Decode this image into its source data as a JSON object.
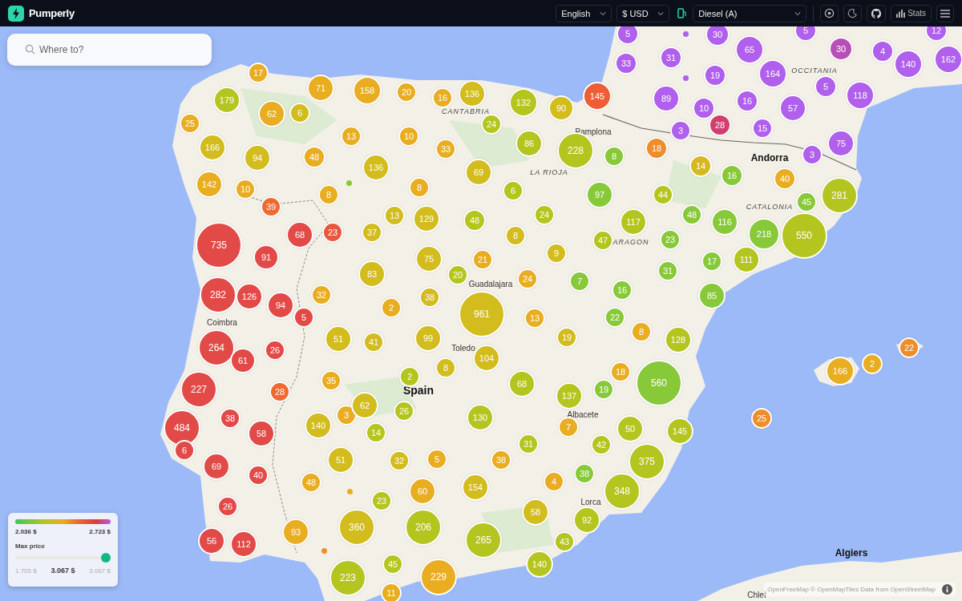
{
  "header": {
    "app_name": "Pumperly",
    "language": "English",
    "currency": "$ USD",
    "fuel": "Diesel (A)",
    "stats_label": "Stats"
  },
  "search": {
    "placeholder": "Where to?"
  },
  "map_labels": [
    {
      "text": "CANTABRIA",
      "kind": "region"
    },
    {
      "text": "Pamplona",
      "kind": "city"
    },
    {
      "text": "LA RIOJA",
      "kind": "region"
    },
    {
      "text": "OCCITANIA",
      "kind": "region"
    },
    {
      "text": "Andorra",
      "kind": "major"
    },
    {
      "text": "CATALONIA",
      "kind": "region"
    },
    {
      "text": "ARAGON",
      "kind": "region"
    },
    {
      "text": "Guadalajara",
      "kind": "city"
    },
    {
      "text": "Toledo",
      "kind": "city"
    },
    {
      "text": "Spain",
      "kind": "country"
    },
    {
      "text": "Coimbra",
      "kind": "city"
    },
    {
      "text": "Albacete",
      "kind": "city"
    },
    {
      "text": "Lorca",
      "kind": "city"
    },
    {
      "text": "Algiers",
      "kind": "major"
    },
    {
      "text": "Chlef",
      "kind": "city"
    }
  ],
  "clusters": [
    {
      "kind": "cluster",
      "count": "5",
      "color": "#b060ec"
    },
    {
      "kind": "dot",
      "color": "#b060ec"
    },
    {
      "kind": "cluster",
      "count": "30",
      "color": "#b060ec"
    },
    {
      "kind": "cluster",
      "count": "5",
      "color": "#b060ec"
    },
    {
      "kind": "cluster",
      "count": "12",
      "color": "#b060ec"
    },
    {
      "kind": "cluster",
      "count": "17",
      "color": "#e9ad22"
    },
    {
      "kind": "cluster",
      "count": "33",
      "color": "#b060ec"
    },
    {
      "kind": "cluster",
      "count": "31",
      "color": "#b060ec"
    },
    {
      "kind": "dot",
      "color": "#b060ec"
    },
    {
      "kind": "cluster",
      "count": "19",
      "color": "#b060ec"
    },
    {
      "kind": "cluster",
      "count": "65",
      "color": "#b060ec"
    },
    {
      "kind": "cluster",
      "count": "164",
      "color": "#b060ec"
    },
    {
      "kind": "cluster",
      "count": "30",
      "color": "#b84fb6"
    },
    {
      "kind": "cluster",
      "count": "4",
      "color": "#b060ec"
    },
    {
      "kind": "cluster",
      "count": "140",
      "color": "#b060ec"
    },
    {
      "kind": "cluster",
      "count": "162",
      "color": "#b060ec"
    },
    {
      "kind": "cluster",
      "count": "179",
      "color": "#b5c51f"
    },
    {
      "kind": "cluster",
      "count": "71",
      "color": "#e9ad22"
    },
    {
      "kind": "cluster",
      "count": "158",
      "color": "#e9ad22"
    },
    {
      "kind": "cluster",
      "count": "20",
      "color": "#e9ad22"
    },
    {
      "kind": "cluster",
      "count": "16",
      "color": "#e9ad22"
    },
    {
      "kind": "cluster",
      "count": "136",
      "color": "#d2bc1e"
    },
    {
      "kind": "cluster",
      "count": "132",
      "color": "#b5c51f"
    },
    {
      "kind": "cluster",
      "count": "90",
      "color": "#d2bc1e"
    },
    {
      "kind": "cluster",
      "count": "145",
      "color": "#ee5e36"
    },
    {
      "kind": "cluster",
      "count": "89",
      "color": "#b060ec"
    },
    {
      "kind": "cluster",
      "count": "10",
      "color": "#b060ec"
    },
    {
      "kind": "cluster",
      "count": "16",
      "color": "#b060ec"
    },
    {
      "kind": "cluster",
      "count": "57",
      "color": "#b060ec"
    },
    {
      "kind": "cluster",
      "count": "5",
      "color": "#b060ec"
    },
    {
      "kind": "cluster",
      "count": "118",
      "color": "#b060ec"
    },
    {
      "kind": "cluster",
      "count": "25",
      "color": "#e9ad22"
    },
    {
      "kind": "cluster",
      "count": "62",
      "color": "#e9ad22"
    },
    {
      "kind": "cluster",
      "count": "6",
      "color": "#d2bc1e"
    },
    {
      "kind": "cluster",
      "count": "13",
      "color": "#e9ad22"
    },
    {
      "kind": "cluster",
      "count": "10",
      "color": "#e9ad22"
    },
    {
      "kind": "cluster",
      "count": "24",
      "color": "#b5c51f"
    },
    {
      "kind": "cluster",
      "count": "3",
      "color": "#b060ec"
    },
    {
      "kind": "cluster",
      "count": "28",
      "color": "#d13f6f"
    },
    {
      "kind": "cluster",
      "count": "15",
      "color": "#b060ec"
    },
    {
      "kind": "cluster",
      "count": "166",
      "color": "#d2bc1e"
    },
    {
      "kind": "cluster",
      "count": "94",
      "color": "#d2bc1e"
    },
    {
      "kind": "cluster",
      "count": "48",
      "color": "#e9ad22"
    },
    {
      "kind": "cluster",
      "count": "136",
      "color": "#d2bc1e"
    },
    {
      "kind": "cluster",
      "count": "33",
      "color": "#e9ad22"
    },
    {
      "kind": "cluster",
      "count": "86",
      "color": "#b5c51f"
    },
    {
      "kind": "cluster",
      "count": "228",
      "color": "#b5c51f"
    },
    {
      "kind": "cluster",
      "count": "8",
      "color": "#88c93a"
    },
    {
      "kind": "cluster",
      "count": "18",
      "color": "#ef8c2b"
    },
    {
      "kind": "cluster",
      "count": "14",
      "color": "#d6b91e"
    },
    {
      "kind": "cluster",
      "count": "3",
      "color": "#b060ec"
    },
    {
      "kind": "cluster",
      "count": "75",
      "color": "#b060ec"
    },
    {
      "kind": "cluster",
      "count": "142",
      "color": "#e9ad22"
    },
    {
      "kind": "cluster",
      "count": "10",
      "color": "#e9ad22"
    },
    {
      "kind": "cluster",
      "count": "39",
      "color": "#ee6a30"
    },
    {
      "kind": "cluster",
      "count": "8",
      "color": "#e9ad22"
    },
    {
      "kind": "dot",
      "color": "#88c93a"
    },
    {
      "kind": "cluster",
      "count": "8",
      "color": "#e9ad22"
    },
    {
      "kind": "cluster",
      "count": "69",
      "color": "#d2bc1e"
    },
    {
      "kind": "cluster",
      "count": "6",
      "color": "#b5c51f"
    },
    {
      "kind": "cluster",
      "count": "97",
      "color": "#88c93a"
    },
    {
      "kind": "cluster",
      "count": "44",
      "color": "#b5c51f"
    },
    {
      "kind": "cluster",
      "count": "16",
      "color": "#88c93a"
    },
    {
      "kind": "cluster",
      "count": "40",
      "color": "#e9ad22"
    },
    {
      "kind": "cluster",
      "count": "45",
      "color": "#88c93a"
    },
    {
      "kind": "cluster",
      "count": "281",
      "color": "#b5c51f"
    },
    {
      "kind": "cluster",
      "count": "735",
      "color": "#e24a48"
    },
    {
      "kind": "cluster",
      "count": "91",
      "color": "#e24a48"
    },
    {
      "kind": "cluster",
      "count": "68",
      "color": "#e24a48"
    },
    {
      "kind": "cluster",
      "count": "23",
      "color": "#e8583e"
    },
    {
      "kind": "cluster",
      "count": "37",
      "color": "#d2bc1e"
    },
    {
      "kind": "cluster",
      "count": "13",
      "color": "#d2bc1e"
    },
    {
      "kind": "cluster",
      "count": "129",
      "color": "#d2bc1e"
    },
    {
      "kind": "cluster",
      "count": "48",
      "color": "#b5c51f"
    },
    {
      "kind": "cluster",
      "count": "8",
      "color": "#d2bc1e"
    },
    {
      "kind": "cluster",
      "count": "24",
      "color": "#b5c51f"
    },
    {
      "kind": "cluster",
      "count": "47",
      "color": "#b5c51f"
    },
    {
      "kind": "cluster",
      "count": "117",
      "color": "#b5c51f"
    },
    {
      "kind": "cluster",
      "count": "23",
      "color": "#88c93a"
    },
    {
      "kind": "cluster",
      "count": "48",
      "color": "#88c93a"
    },
    {
      "kind": "cluster",
      "count": "116",
      "color": "#88c93a"
    },
    {
      "kind": "cluster",
      "count": "218",
      "color": "#88c93a"
    },
    {
      "kind": "cluster",
      "count": "550",
      "color": "#b5c51f"
    },
    {
      "kind": "cluster",
      "count": "83",
      "color": "#d2bc1e"
    },
    {
      "kind": "cluster",
      "count": "75",
      "color": "#d2bc1e"
    },
    {
      "kind": "cluster",
      "count": "20",
      "color": "#b5c51f"
    },
    {
      "kind": "cluster",
      "count": "21",
      "color": "#e9ad22"
    },
    {
      "kind": "cluster",
      "count": "24",
      "color": "#e9ad22"
    },
    {
      "kind": "cluster",
      "count": "9",
      "color": "#d2bc1e"
    },
    {
      "kind": "cluster",
      "count": "7",
      "color": "#88c93a"
    },
    {
      "kind": "cluster",
      "count": "31",
      "color": "#88c93a"
    },
    {
      "kind": "cluster",
      "count": "17",
      "color": "#88c93a"
    },
    {
      "kind": "cluster",
      "count": "111",
      "color": "#b5c51f"
    },
    {
      "kind": "cluster",
      "count": "282",
      "color": "#e24a48"
    },
    {
      "kind": "cluster",
      "count": "126",
      "color": "#e24a48"
    },
    {
      "kind": "cluster",
      "count": "94",
      "color": "#e24a48"
    },
    {
      "kind": "cluster",
      "count": "5",
      "color": "#e24a48"
    },
    {
      "kind": "cluster",
      "count": "32",
      "color": "#e9ad22"
    },
    {
      "kind": "cluster",
      "count": "2",
      "color": "#e9ad22"
    },
    {
      "kind": "cluster",
      "count": "38",
      "color": "#d2bc1e"
    },
    {
      "kind": "cluster",
      "count": "961",
      "color": "#d2bc1e"
    },
    {
      "kind": "cluster",
      "count": "13",
      "color": "#e9ad22"
    },
    {
      "kind": "cluster",
      "count": "16",
      "color": "#88c93a"
    },
    {
      "kind": "cluster",
      "count": "22",
      "color": "#88c93a"
    },
    {
      "kind": "cluster",
      "count": "85",
      "color": "#88c93a"
    },
    {
      "kind": "cluster",
      "count": "264",
      "color": "#e24a48"
    },
    {
      "kind": "cluster",
      "count": "61",
      "color": "#e24a48"
    },
    {
      "kind": "cluster",
      "count": "26",
      "color": "#e24a48"
    },
    {
      "kind": "cluster",
      "count": "51",
      "color": "#d2bc1e"
    },
    {
      "kind": "cluster",
      "count": "41",
      "color": "#d2bc1e"
    },
    {
      "kind": "cluster",
      "count": "99",
      "color": "#d2bc1e"
    },
    {
      "kind": "cluster",
      "count": "19",
      "color": "#d2bc1e"
    },
    {
      "kind": "cluster",
      "count": "8",
      "color": "#e9ad22"
    },
    {
      "kind": "cluster",
      "count": "128",
      "color": "#b5c51f"
    },
    {
      "kind": "cluster",
      "count": "22",
      "color": "#ef8c2b"
    },
    {
      "kind": "cluster",
      "count": "35",
      "color": "#e9ad22"
    },
    {
      "kind": "cluster",
      "count": "2",
      "color": "#b5c51f"
    },
    {
      "kind": "cluster",
      "count": "8",
      "color": "#d2bc1e"
    },
    {
      "kind": "cluster",
      "count": "104",
      "color": "#d2bc1e"
    },
    {
      "kind": "cluster",
      "count": "68",
      "color": "#b5c51f"
    },
    {
      "kind": "cluster",
      "count": "18",
      "color": "#e9ad22"
    },
    {
      "kind": "cluster",
      "count": "560",
      "color": "#88c93a"
    },
    {
      "kind": "cluster",
      "count": "166",
      "color": "#e9ad22"
    },
    {
      "kind": "cluster",
      "count": "2",
      "color": "#e9ad22"
    },
    {
      "kind": "cluster",
      "count": "227",
      "color": "#e24a48"
    },
    {
      "kind": "cluster",
      "count": "28",
      "color": "#ee6a30"
    },
    {
      "kind": "cluster",
      "count": "3",
      "color": "#e9ad22"
    },
    {
      "kind": "cluster",
      "count": "62",
      "color": "#d2bc1e"
    },
    {
      "kind": "cluster",
      "count": "26",
      "color": "#b5c51f"
    },
    {
      "kind": "cluster",
      "count": "137",
      "color": "#b5c51f"
    },
    {
      "kind": "cluster",
      "count": "19",
      "color": "#88c93a"
    },
    {
      "kind": "cluster",
      "count": "484",
      "color": "#e24a48"
    },
    {
      "kind": "cluster",
      "count": "38",
      "color": "#e24a48"
    },
    {
      "kind": "cluster",
      "count": "58",
      "color": "#e24a48"
    },
    {
      "kind": "cluster",
      "count": "140",
      "color": "#d2bc1e"
    },
    {
      "kind": "cluster",
      "count": "14",
      "color": "#b5c51f"
    },
    {
      "kind": "cluster",
      "count": "130",
      "color": "#b5c51f"
    },
    {
      "kind": "cluster",
      "count": "31",
      "color": "#b5c51f"
    },
    {
      "kind": "cluster",
      "count": "7",
      "color": "#e9ad22"
    },
    {
      "kind": "cluster",
      "count": "42",
      "color": "#b5c51f"
    },
    {
      "kind": "cluster",
      "count": "50",
      "color": "#b5c51f"
    },
    {
      "kind": "cluster",
      "count": "145",
      "color": "#b5c51f"
    },
    {
      "kind": "cluster",
      "count": "25",
      "color": "#ef8c2b"
    },
    {
      "kind": "cluster",
      "count": "6",
      "color": "#e24a48"
    },
    {
      "kind": "cluster",
      "count": "69",
      "color": "#e24a48"
    },
    {
      "kind": "cluster",
      "count": "40",
      "color": "#e24a48"
    },
    {
      "kind": "cluster",
      "count": "51",
      "color": "#d2bc1e"
    },
    {
      "kind": "cluster",
      "count": "32",
      "color": "#d2bc1e"
    },
    {
      "kind": "cluster",
      "count": "5",
      "color": "#e9ad22"
    },
    {
      "kind": "cluster",
      "count": "38",
      "color": "#e9ad22"
    },
    {
      "kind": "cluster",
      "count": "38",
      "color": "#88c93a"
    },
    {
      "kind": "cluster",
      "count": "375",
      "color": "#b5c51f"
    },
    {
      "kind": "cluster",
      "count": "26",
      "color": "#e24a48"
    },
    {
      "kind": "cluster",
      "count": "48",
      "color": "#e9ad22"
    },
    {
      "kind": "dot",
      "color": "#e9ad22"
    },
    {
      "kind": "cluster",
      "count": "23",
      "color": "#b5c51f"
    },
    {
      "kind": "cluster",
      "count": "60",
      "color": "#e9ad22"
    },
    {
      "kind": "cluster",
      "count": "154",
      "color": "#d2bc1e"
    },
    {
      "kind": "cluster",
      "count": "4",
      "color": "#e9ad22"
    },
    {
      "kind": "cluster",
      "count": "58",
      "color": "#d2bc1e"
    },
    {
      "kind": "cluster",
      "count": "92",
      "color": "#b5c51f"
    },
    {
      "kind": "cluster",
      "count": "348",
      "color": "#b5c51f"
    },
    {
      "kind": "cluster",
      "count": "56",
      "color": "#e24a48"
    },
    {
      "kind": "cluster",
      "count": "112",
      "color": "#e24a48"
    },
    {
      "kind": "cluster",
      "count": "93",
      "color": "#e9ad22"
    },
    {
      "kind": "dot",
      "color": "#ef8c2b"
    },
    {
      "kind": "cluster",
      "count": "360",
      "color": "#d2bc1e"
    },
    {
      "kind": "cluster",
      "count": "206",
      "color": "#b5c51f"
    },
    {
      "kind": "cluster",
      "count": "265",
      "color": "#b5c51f"
    },
    {
      "kind": "cluster",
      "count": "43",
      "color": "#b5c51f"
    },
    {
      "kind": "cluster",
      "count": "223",
      "color": "#b5c51f"
    },
    {
      "kind": "cluster",
      "count": "45",
      "color": "#b5c51f"
    },
    {
      "kind": "cluster",
      "count": "11",
      "color": "#e9ad22"
    },
    {
      "kind": "cluster",
      "count": "229",
      "color": "#e9ad22"
    },
    {
      "kind": "cluster",
      "count": "140",
      "color": "#b5c51f"
    }
  ],
  "legend": {
    "min_label": "2.036 $",
    "max_label": "2.723 $",
    "slider_title": "Max price",
    "level": 1.0,
    "range_min": "1.705 $",
    "current": "3.067 $",
    "range_max": "3.067 $"
  },
  "attribution": "OpenFreeMap © OpenMapTiles Data from OpenStreetMap"
}
